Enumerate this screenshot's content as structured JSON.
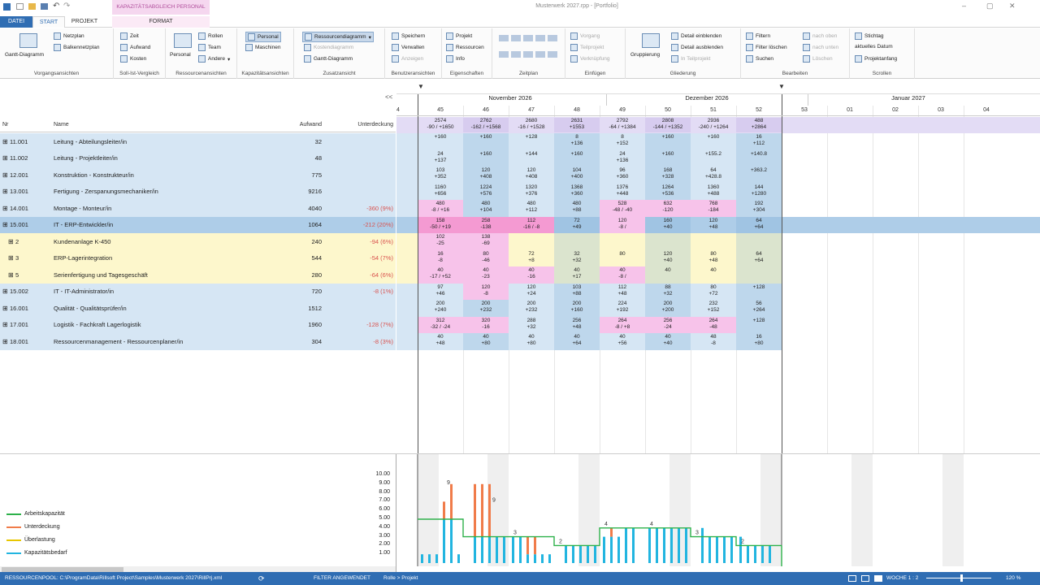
{
  "title": "Musterwerk 2027.rpp - [Portfolio]",
  "context_tab": "KAPAZITÄTSABGLEICH PERSONAL",
  "tabs": [
    "DATEI",
    "START",
    "PROJEKT",
    "FORMAT"
  ],
  "ribbon": {
    "groups": [
      {
        "label": "Vorgangsansichten",
        "items": [
          "Gantt-Diagramm",
          "Netzplan",
          "Balkennetzplan"
        ]
      },
      {
        "label": "Soll-Ist-Vergleich",
        "items": [
          "Zeit",
          "Aufwand",
          "Kosten"
        ]
      },
      {
        "label": "Ressourcenansichten",
        "items": [
          "Personal",
          "Rollen",
          "Team",
          "Andere"
        ]
      },
      {
        "label": "Kapazitätsansichten",
        "items": [
          "Personal",
          "Maschinen"
        ]
      },
      {
        "label": "Zusatzansicht",
        "items": [
          "Ressourcendiagramm",
          "Kostendiagramm",
          "Gantt-Diagramm"
        ]
      },
      {
        "label": "Benutzeransichten",
        "items": [
          "Speichern",
          "Verwalten",
          "Anzeigen"
        ]
      },
      {
        "label": "Eigenschaften",
        "items": [
          "Projekt",
          "Ressourcen",
          "Info"
        ]
      },
      {
        "label": "Zeitplan",
        "items": []
      },
      {
        "label": "Einfügen",
        "items": [
          "Vorgang",
          "Teilprojekt",
          "Verknüpfung"
        ]
      },
      {
        "label": "Gliederung",
        "items": [
          "Gruppierung",
          "Detail einblenden",
          "Detail ausblenden",
          "In Teilprojekt"
        ]
      },
      {
        "label": "Bearbeiten",
        "items": [
          "Filtern",
          "Filter löschen",
          "Suchen",
          "nach oben",
          "nach unten",
          "Löschen"
        ]
      },
      {
        "label": "Scrollen",
        "items": [
          "Stichtag",
          "aktuelles Datum",
          "Projektanfang"
        ]
      }
    ]
  },
  "table": {
    "collapse_label": "<<",
    "columns": [
      "Nr",
      "Name",
      "Aufwand",
      "Unterdeckung"
    ],
    "rows": [
      {
        "nr": "11.001",
        "name": "Leitung - Abteilungsleiter/in",
        "aufwand": "32",
        "unter": ""
      },
      {
        "nr": "11.002",
        "name": "Leitung - Projektleiter/in",
        "aufwand": "48",
        "unter": ""
      },
      {
        "nr": "12.001",
        "name": "Konstruktion - Konstrukteur/in",
        "aufwand": "775",
        "unter": ""
      },
      {
        "nr": "13.001",
        "name": "Fertigung - Zerspanungsmechaniker/in",
        "aufwand": "9216",
        "unter": ""
      },
      {
        "nr": "14.001",
        "name": "Montage - Monteur/in",
        "aufwand": "4040",
        "unter": "-360 (9%)"
      },
      {
        "nr": "15.001",
        "name": "IT - ERP-Entwickler/in",
        "aufwand": "1064",
        "unter": "-212 (20%)"
      },
      {
        "nr": "2",
        "name": "Kundenanlage K-450",
        "aufwand": "240",
        "unter": "-94 (6%)"
      },
      {
        "nr": "3",
        "name": "ERP-Lagerintegration",
        "aufwand": "544",
        "unter": "-54 (7%)"
      },
      {
        "nr": "5",
        "name": "Serienfertigung und Tagesgeschäft",
        "aufwand": "280",
        "unter": "-64 (6%)"
      },
      {
        "nr": "15.002",
        "name": "IT - IT-Administrator/in",
        "aufwand": "720",
        "unter": "-8 (1%)"
      },
      {
        "nr": "16.001",
        "name": "Qualität - Qualitätsprüfer/in",
        "aufwand": "1512",
        "unter": ""
      },
      {
        "nr": "17.001",
        "name": "Logistik - Fachkraft Lagerlogistik",
        "aufwand": "1960",
        "unter": "-128 (7%)"
      },
      {
        "nr": "18.001",
        "name": "Ressourcenmanagement - Ressourcenplaner/in",
        "aufwand": "304",
        "unter": "-8 (3%)"
      }
    ]
  },
  "timeline": {
    "months": [
      "November 2026",
      "Dezember 2026",
      "Januar 2027"
    ],
    "weeks": [
      "4",
      "45",
      "46",
      "47",
      "48",
      "49",
      "50",
      "51",
      "52",
      "53",
      "01",
      "02",
      "03",
      "04"
    ],
    "summary": [
      [
        "2574",
        "-90 / +1650"
      ],
      [
        "2762",
        "-162 / +1568"
      ],
      [
        "2680",
        "-16 / +1528"
      ],
      [
        "2631",
        "+1553"
      ],
      [
        "2792",
        "-64 / +1384"
      ],
      [
        "2808",
        "-144 / +1352"
      ],
      [
        "2936",
        "-240 / +1264"
      ],
      [
        "488",
        "+2864"
      ]
    ],
    "cells": [
      [
        [
          "",
          "+160"
        ],
        [
          "",
          "+160"
        ],
        [
          "",
          "+128"
        ],
        [
          "8",
          "+136"
        ],
        [
          "8",
          "+152"
        ],
        [
          "",
          "+160"
        ],
        [
          "",
          "+160"
        ],
        [
          "16",
          "+112"
        ]
      ],
      [
        [
          "24",
          "+137"
        ],
        [
          "",
          "+160"
        ],
        [
          "",
          "+144"
        ],
        [
          "",
          "+160"
        ],
        [
          "24",
          "+136"
        ],
        [
          "",
          "+160"
        ],
        [
          "",
          "+155.2"
        ],
        [
          "",
          "+140.8"
        ]
      ],
      [
        [
          "103",
          "+352"
        ],
        [
          "120",
          "+408"
        ],
        [
          "120",
          "+408"
        ],
        [
          "104",
          "+400"
        ],
        [
          "96",
          "+360"
        ],
        [
          "168",
          "+328"
        ],
        [
          "64",
          "+428.8"
        ],
        [
          "",
          "+363.2"
        ]
      ],
      [
        [
          "1160",
          "+656"
        ],
        [
          "1224",
          "+576"
        ],
        [
          "1320",
          "+376"
        ],
        [
          "1368",
          "+360"
        ],
        [
          "1376",
          "+448"
        ],
        [
          "1264",
          "+536"
        ],
        [
          "1360",
          "+488"
        ],
        [
          "144",
          "+1280"
        ]
      ],
      [
        [
          "480",
          "-8 / +16"
        ],
        [
          "480",
          "+104"
        ],
        [
          "480",
          "+112"
        ],
        [
          "480",
          "+88"
        ],
        [
          "528",
          "-48 / -40"
        ],
        [
          "632",
          "-120"
        ],
        [
          "768",
          "-184"
        ],
        [
          "192",
          "+304"
        ]
      ],
      [
        [
          "158",
          "-50 / +19"
        ],
        [
          "258",
          "-138"
        ],
        [
          "112",
          "-16 / -8"
        ],
        [
          "72",
          "+49"
        ],
        [
          "120",
          "-8 /"
        ],
        [
          "160",
          "+40"
        ],
        [
          "120",
          "+48"
        ],
        [
          "64",
          "+64"
        ]
      ],
      [
        [
          "102",
          "-25"
        ],
        [
          "138",
          "-69"
        ],
        [
          "",
          ""
        ],
        [
          "",
          ""
        ],
        [
          "",
          ""
        ],
        [
          "",
          ""
        ],
        [
          "",
          ""
        ],
        [
          "",
          ""
        ]
      ],
      [
        [
          "16",
          "-8"
        ],
        [
          "80",
          "-46"
        ],
        [
          "72",
          "+8"
        ],
        [
          "32",
          "+32"
        ],
        [
          "",
          "80"
        ],
        [
          "120",
          "+40"
        ],
        [
          "80",
          "+48"
        ],
        [
          "64",
          "+64"
        ]
      ],
      [
        [
          "40",
          "-17 / +52"
        ],
        [
          "40",
          "-23"
        ],
        [
          "40",
          "-16"
        ],
        [
          "40",
          "+17"
        ],
        [
          "40",
          "-8 /"
        ],
        [
          "",
          "40"
        ],
        [
          "",
          "40"
        ],
        [
          "",
          ""
        ]
      ],
      [
        [
          "97",
          "+46"
        ],
        [
          "120",
          "-8"
        ],
        [
          "120",
          "+24"
        ],
        [
          "103",
          "+88"
        ],
        [
          "112",
          "+48"
        ],
        [
          "88",
          "+32"
        ],
        [
          "80",
          "+72"
        ],
        [
          "",
          "+128"
        ]
      ],
      [
        [
          "200",
          "+240"
        ],
        [
          "200",
          "+232"
        ],
        [
          "200",
          "+232"
        ],
        [
          "200",
          "+160"
        ],
        [
          "224",
          "+192"
        ],
        [
          "200",
          "+200"
        ],
        [
          "232",
          "+152"
        ],
        [
          "56",
          "+264"
        ]
      ],
      [
        [
          "312",
          "-32 / -24"
        ],
        [
          "320",
          "-16"
        ],
        [
          "288",
          "+32"
        ],
        [
          "256",
          "+48"
        ],
        [
          "264",
          "-8 / +8"
        ],
        [
          "256",
          "-24"
        ],
        [
          "264",
          "-48"
        ],
        [
          "",
          "+128"
        ]
      ],
      [
        [
          "40",
          "+48"
        ],
        [
          "40",
          "+80"
        ],
        [
          "40",
          "+80"
        ],
        [
          "40",
          "+64"
        ],
        [
          "40",
          "+56"
        ],
        [
          "40",
          "+40"
        ],
        [
          "48",
          "-8"
        ],
        [
          "16",
          "+80"
        ]
      ]
    ]
  },
  "chart": {
    "legend": [
      {
        "label": "Arbeitskapazität",
        "color": "#2db14a"
      },
      {
        "label": "Unterdeckung",
        "color": "#f07c4a"
      },
      {
        "label": "Überlastung",
        "color": "#e8c600"
      },
      {
        "label": "Kapazitätsbedarf",
        "color": "#22b5e0"
      }
    ],
    "y_ticks": [
      "10.00",
      "9.00",
      "8.00",
      "7.00",
      "6.00",
      "5.00",
      "4.00",
      "3.00",
      "2.00",
      "1.00"
    ]
  },
  "chart_data": {
    "type": "bar",
    "title": "",
    "ylim": [
      0,
      10
    ],
    "week_labels": [
      "9",
      "9",
      "3",
      "2",
      "4",
      "4",
      "3",
      "2"
    ],
    "capacity_levels": [
      5,
      3,
      3,
      2,
      4,
      4,
      3,
      2
    ],
    "series": [
      {
        "name": "Kapazitätsbedarf",
        "values": [
          1,
          1,
          1,
          5,
          5,
          1,
          3,
          3,
          3,
          3,
          3,
          3,
          3,
          1,
          1,
          1,
          1,
          2,
          2,
          2,
          2,
          2,
          3,
          3,
          3,
          4,
          4,
          4,
          4,
          4,
          4,
          4,
          4,
          4,
          3,
          3,
          3,
          3,
          3,
          2,
          2,
          2,
          2
        ]
      },
      {
        "name": "Unterdeckung",
        "values": [
          0,
          0,
          0,
          2,
          4,
          0,
          6,
          6,
          6,
          0,
          0,
          0,
          0,
          2,
          2,
          0,
          0,
          0,
          0,
          0,
          0,
          0,
          0,
          1,
          0,
          0,
          0,
          0,
          0,
          0,
          0,
          0,
          0,
          0,
          0,
          0,
          0,
          0,
          0,
          0,
          0,
          0,
          0
        ]
      }
    ]
  },
  "status": {
    "pool": "RESSOURCENPOOL: C:\\ProgramData\\Rillsoft Project\\Samples\\Musterwerk 2027\\RillPrj.xml",
    "filter": "FILTER ANGEWENDET",
    "role": "Rolle > Projekt",
    "week": "WOCHE 1 : 2",
    "zoom": "120 %"
  }
}
